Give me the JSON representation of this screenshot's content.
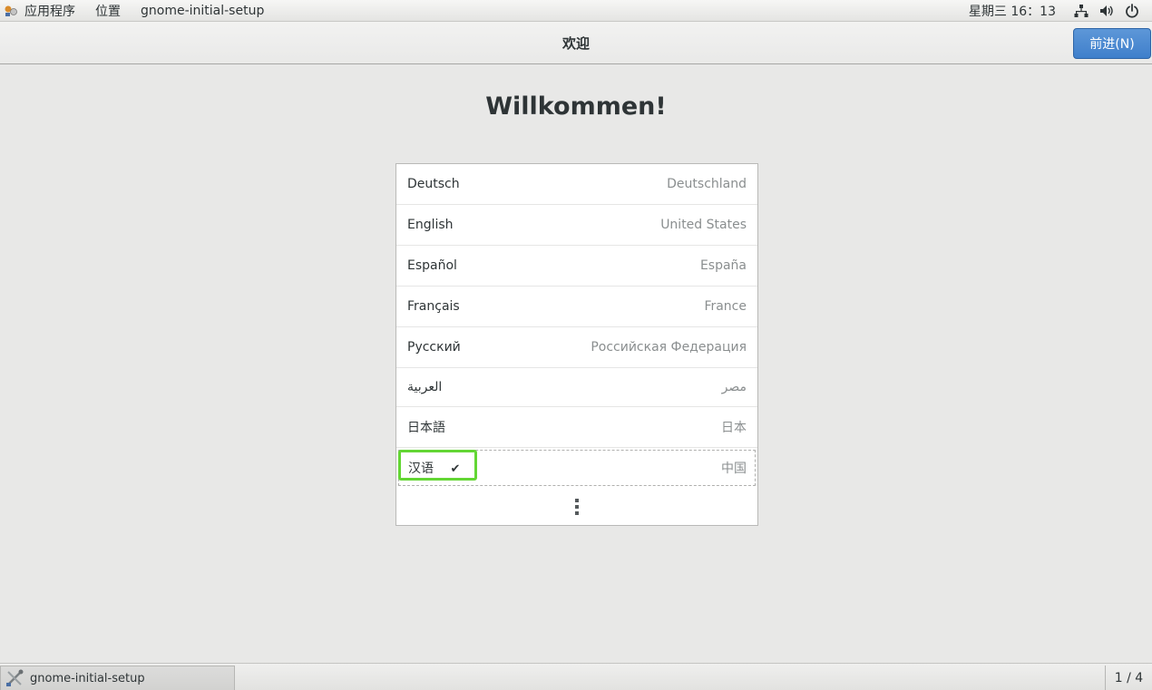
{
  "top_panel": {
    "applications_label": "应用程序",
    "places_label": "位置",
    "app_name": "gnome-initial-setup",
    "clock": "星期三 16：13"
  },
  "header": {
    "title": "欢迎",
    "next_button": "前进(N)"
  },
  "main": {
    "heading": "Willkommen!",
    "languages": [
      {
        "name": "Deutsch",
        "region": "Deutschland"
      },
      {
        "name": "English",
        "region": "United States"
      },
      {
        "name": "Español",
        "region": "España"
      },
      {
        "name": "Français",
        "region": "France"
      },
      {
        "name": "Русский",
        "region": "Российская Федерация"
      },
      {
        "name": "العربية",
        "region": "مصر"
      },
      {
        "name": "日本語",
        "region": "日本"
      },
      {
        "name": "汉语",
        "region": "中国",
        "selected": true
      }
    ],
    "selected_mark": "✔",
    "more_icon": "vertical-ellipsis-icon"
  },
  "taskbar": {
    "task_label": "gnome-initial-setup",
    "workspace": "1 / 4"
  },
  "colors": {
    "accent": "#4a89d2",
    "highlight": "#63d634"
  }
}
